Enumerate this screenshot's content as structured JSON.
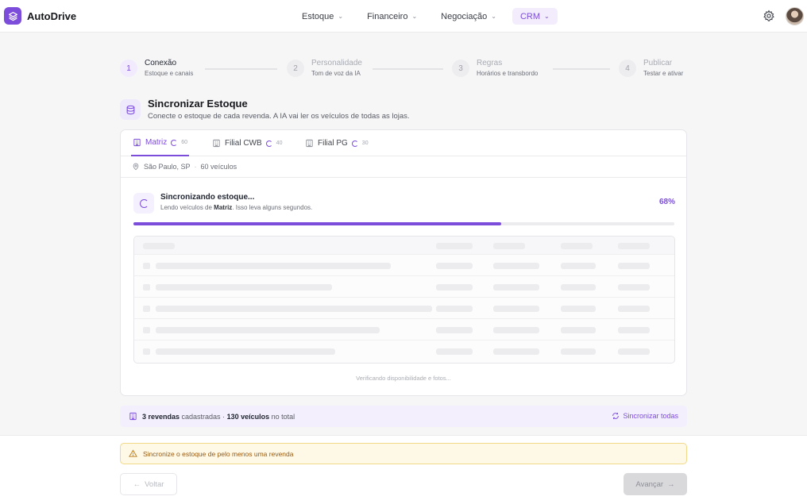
{
  "app": {
    "name": "AutoDrive",
    "accent": "#7c4ddb"
  },
  "nav": {
    "items": [
      {
        "label": "Estoque",
        "icon": "chevron-down-icon"
      },
      {
        "label": "Financeiro",
        "icon": "chevron-down-icon"
      },
      {
        "label": "Negociação",
        "icon": "chevron-down-icon"
      },
      {
        "label": "CRM",
        "icon": "chevron-down-icon",
        "active": true
      }
    ]
  },
  "header": {
    "settings_icon": "gear-icon",
    "avatar": "user-avatar"
  },
  "steps": [
    {
      "num": "1",
      "title": "Conexão",
      "subtitle": "Estoque e canais",
      "active": true
    },
    {
      "num": "2",
      "title": "Personalidade",
      "subtitle": "Tom de voz da IA"
    },
    {
      "num": "3",
      "title": "Regras",
      "subtitle": "Horários e transbordo"
    },
    {
      "num": "4",
      "title": "Publicar",
      "subtitle": "Testar e ativar"
    }
  ],
  "section": {
    "icon": "database-icon",
    "title": "Sincronizar Estoque",
    "subtitle": "Conecte o estoque de cada revenda. A IA vai ler os veículos de todas as lojas."
  },
  "tabs": [
    {
      "label": "Matriz",
      "count": "60",
      "active": true
    },
    {
      "label": "Filial CWB",
      "count": "40"
    },
    {
      "label": "Filial PG",
      "count": "30"
    }
  ],
  "location": {
    "city": "São Paulo, SP",
    "separator": "·",
    "vehicles": "60 veículos"
  },
  "sync": {
    "title": "Sincronizando estoque...",
    "desc_prefix": "Lendo veículos de",
    "desc_store": "Matriz",
    "desc_suffix": ". Isso leva alguns segundos.",
    "percent_label": "68%",
    "progress": 0.68
  },
  "verifying": "Verificando disponibilidade e fotos...",
  "summary": {
    "stores": "3 revendas",
    "stores_suffix": " cadastradas · ",
    "vehicles": "130 veículos",
    "vehicles_suffix": " no total",
    "sync_all": "Sincronizar todas"
  },
  "alert": {
    "text": "Sincronize o estoque de pelo menos uma revenda",
    "icon": "warning-icon"
  },
  "buttons": {
    "back": "Voltar",
    "next": "Avançar"
  }
}
